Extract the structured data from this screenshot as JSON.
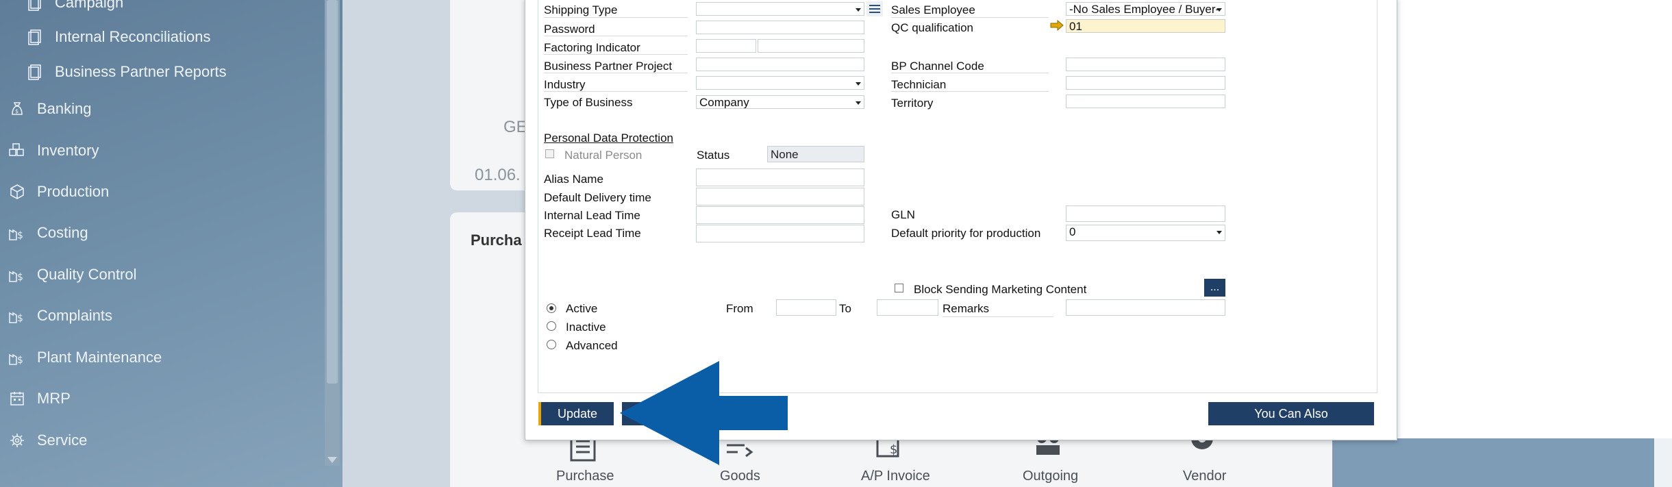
{
  "nav": {
    "sub_items": [
      {
        "label": "Campaign",
        "icon": "document-icon"
      },
      {
        "label": "Internal Reconciliations",
        "icon": "document-icon"
      },
      {
        "label": "Business Partner Reports",
        "icon": "document-icon"
      }
    ],
    "modules": [
      {
        "label": "Banking",
        "icon": "money-bag-icon"
      },
      {
        "label": "Inventory",
        "icon": "boxes-icon"
      },
      {
        "label": "Production",
        "icon": "cube-icon"
      },
      {
        "label": "Costing",
        "icon": "factory-dollar-icon"
      },
      {
        "label": "Quality Control",
        "icon": "factory-dollar-icon"
      },
      {
        "label": "Complaints",
        "icon": "factory-dollar-icon"
      },
      {
        "label": "Plant Maintenance",
        "icon": "factory-dollar-icon"
      },
      {
        "label": "MRP",
        "icon": "calendar-icon"
      },
      {
        "label": "Service",
        "icon": "service-gear-icon"
      }
    ]
  },
  "background": {
    "partial_text_1": "GE",
    "partial_date": "01.06.",
    "partial_heading": "Purcha",
    "flow": [
      "Purchase",
      "Goods",
      "A/P Invoice",
      "Outgoing",
      "Vendor"
    ]
  },
  "form": {
    "shipping_type_label": "Shipping Type",
    "shipping_type_value": "",
    "password_label": "Password",
    "password_value": "",
    "factoring_label": "Factoring Indicator",
    "bp_project_label": "Business Partner Project",
    "industry_label": "Industry",
    "type_of_business_label": "Type of Business",
    "type_of_business_value": "Company",
    "sales_employee_label": "Sales Employee",
    "sales_employee_value": "-No Sales Employee / Buyer-",
    "qc_label": "QC qualification",
    "qc_value": "01",
    "bp_channel_label": "BP Channel Code",
    "technician_label": "Technician",
    "territory_label": "Territory",
    "pdp_heading": "Personal Data Protection",
    "natural_person_label": "Natural Person",
    "status_label": "Status",
    "status_value": "None",
    "alias_label": "Alias Name",
    "delivery_time_label": "Default Delivery time",
    "internal_lead_label": "Internal Lead Time",
    "receipt_lead_label": "Receipt Lead Time",
    "gln_label": "GLN",
    "priority_label": "Default priority for production",
    "priority_value": "0",
    "block_marketing_label": "Block Sending Marketing Content",
    "ellipsis_label": "...",
    "active_label": "Active",
    "inactive_label": "Inactive",
    "advanced_label": "Advanced",
    "from_label": "From",
    "to_label": "To",
    "remarks_label": "Remarks"
  },
  "footer": {
    "update_label": "Update",
    "you_can_also_label": "You Can Also"
  },
  "colors": {
    "accent_dark": "#1f3f66",
    "arrow_blue": "#0a5ea8",
    "highlight_yellow": "#fdf3cc",
    "arrow_icon": "#e0a800"
  }
}
